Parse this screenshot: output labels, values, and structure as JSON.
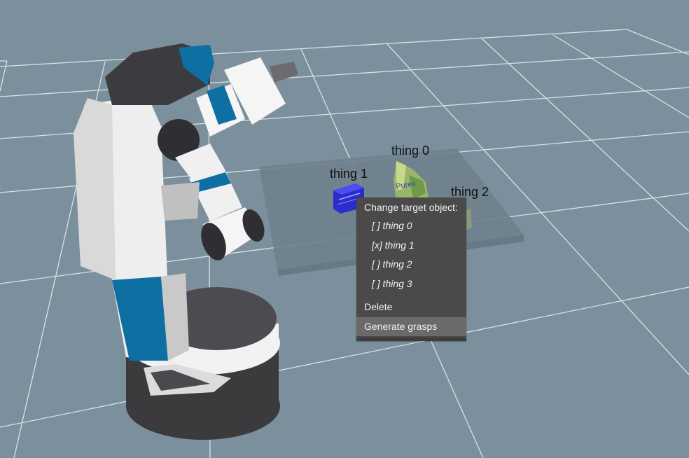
{
  "scene": {
    "object_labels": [
      "thing 0",
      "thing 1",
      "thing 2"
    ]
  },
  "menu": {
    "header": "Change target object:",
    "options": [
      "[ ] thing 0",
      "[x] thing 1",
      "[ ] thing 2",
      "[ ] thing 3"
    ],
    "actions": [
      "Delete",
      "Generate grasps"
    ],
    "highlighted_action": "Generate grasps"
  },
  "colors": {
    "background": "#7b909c",
    "grid_line": "#d8e0e4",
    "table_surface": "#6e818c",
    "menu_bg": "#4a4a4a",
    "menu_highlight": "#6a6a6a",
    "robot_blue": "#0e6fa2",
    "box_blue": "#2a2ccc"
  }
}
